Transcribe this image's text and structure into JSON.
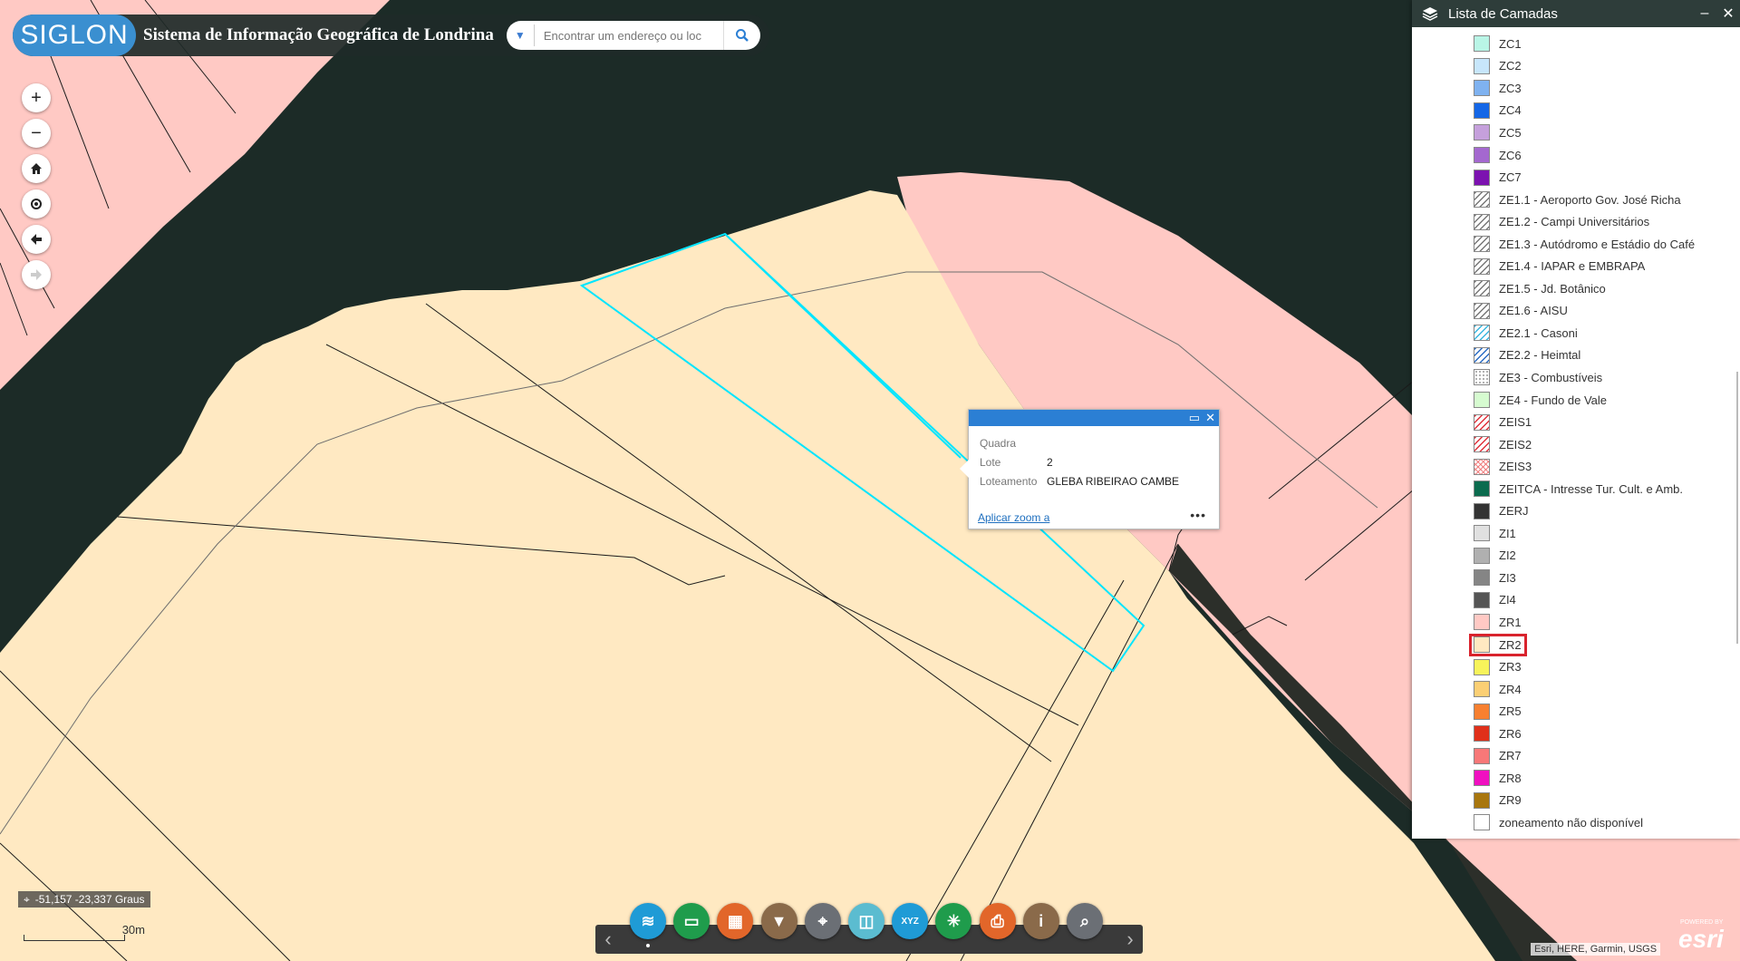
{
  "header": {
    "logo_text": "SIGLON",
    "app_title": "Sistema de Informação Geográfica de Londrina",
    "search_placeholder": "Encontrar um endereço ou loc"
  },
  "nav": [
    "zoom-in",
    "zoom-out",
    "home",
    "locate",
    "previous-extent",
    "next-extent"
  ],
  "popup": {
    "fields": [
      {
        "label": "Quadra",
        "value": ""
      },
      {
        "label": "Lote",
        "value": "2"
      },
      {
        "label": "Loteamento",
        "value": "GLEBA RIBEIRAO CAMBE"
      }
    ],
    "zoom_link": "Aplicar zoom a",
    "more": "•••"
  },
  "layer_panel": {
    "title": "Lista de Camadas",
    "minimize": "–",
    "close": "✕",
    "items": [
      {
        "label": "ZC1",
        "color": "#b9f5e6",
        "pattern": "solid"
      },
      {
        "label": "ZC2",
        "color": "#c7e6fb",
        "pattern": "solid"
      },
      {
        "label": "ZC3",
        "color": "#7fb2f0",
        "pattern": "solid"
      },
      {
        "label": "ZC4",
        "color": "#1466e6",
        "pattern": "solid"
      },
      {
        "label": "ZC5",
        "color": "#c5a0dc",
        "pattern": "solid"
      },
      {
        "label": "ZC6",
        "color": "#a468cf",
        "pattern": "solid"
      },
      {
        "label": "ZC7",
        "color": "#7c12b0",
        "pattern": "solid"
      },
      {
        "label": "ZE1.1 - Aeroporto Gov. José Richa",
        "color": "#777777",
        "pattern": "hatch"
      },
      {
        "label": "ZE1.2 - Campi Universitários",
        "color": "#777777",
        "pattern": "hatch"
      },
      {
        "label": "ZE1.3 - Autódromo e Estádio do Café",
        "color": "#777777",
        "pattern": "hatch"
      },
      {
        "label": "ZE1.4 - IAPAR e EMBRAPA",
        "color": "#777777",
        "pattern": "hatch"
      },
      {
        "label": "ZE1.5 - Jd. Botânico",
        "color": "#777777",
        "pattern": "hatch"
      },
      {
        "label": "ZE1.6 - AISU",
        "color": "#777777",
        "pattern": "hatch"
      },
      {
        "label": "ZE2.1 - Casoni",
        "color": "#39b7e0",
        "pattern": "hatch"
      },
      {
        "label": "ZE2.2 - Heimtal",
        "color": "#2a6cc4",
        "pattern": "hatch"
      },
      {
        "label": "ZE3 - Combustíveis",
        "color": "#999999",
        "pattern": "dots"
      },
      {
        "label": "ZE4 - Fundo de Vale",
        "color": "#d6fbd0",
        "pattern": "solid"
      },
      {
        "label": "ZEIS1",
        "color": "#e0303a",
        "pattern": "hatch"
      },
      {
        "label": "ZEIS2",
        "color": "#e0303a",
        "pattern": "hatch"
      },
      {
        "label": "ZEIS3",
        "color": "#f08080",
        "pattern": "cross"
      },
      {
        "label": "ZEITCA - Intresse Tur. Cult. e Amb.",
        "color": "#0b6b4e",
        "pattern": "solid"
      },
      {
        "label": "ZERJ",
        "color": "#333333",
        "pattern": "solid"
      },
      {
        "label": "ZI1",
        "color": "#e0e0e0",
        "pattern": "solid"
      },
      {
        "label": "ZI2",
        "color": "#b0b0b0",
        "pattern": "solid"
      },
      {
        "label": "ZI3",
        "color": "#858585",
        "pattern": "solid"
      },
      {
        "label": "ZI4",
        "color": "#555555",
        "pattern": "solid"
      },
      {
        "label": "ZR1",
        "color": "#ffc9c4",
        "pattern": "solid"
      },
      {
        "label": "ZR2",
        "color": "#ffe9c2",
        "pattern": "solid",
        "highlighted": true
      },
      {
        "label": "ZR3",
        "color": "#f7f35a",
        "pattern": "solid"
      },
      {
        "label": "ZR4",
        "color": "#fbcf74",
        "pattern": "solid"
      },
      {
        "label": "ZR5",
        "color": "#f88030",
        "pattern": "solid"
      },
      {
        "label": "ZR6",
        "color": "#e0301a",
        "pattern": "solid"
      },
      {
        "label": "ZR7",
        "color": "#f87878",
        "pattern": "solid"
      },
      {
        "label": "ZR8",
        "color": "#f010c0",
        "pattern": "solid"
      },
      {
        "label": "ZR9",
        "color": "#a8760e",
        "pattern": "solid"
      },
      {
        "label": "zoneamento não disponível",
        "color": "#ffffff",
        "pattern": "solid"
      }
    ]
  },
  "coords": {
    "text": "-51,157 -23,337 Graus"
  },
  "scale": {
    "text": "30m"
  },
  "toolbar": {
    "prev": "‹",
    "next": "›",
    "tools": [
      {
        "name": "layers-tool",
        "glyph": "≋",
        "color": "#1f9bd6"
      },
      {
        "name": "measure-tool",
        "glyph": "▭",
        "color": "#1f9c4c"
      },
      {
        "name": "basemap-tool",
        "glyph": "▦",
        "color": "#e2662a"
      },
      {
        "name": "filter-tool",
        "glyph": "▼",
        "color": "#8a6a4a"
      },
      {
        "name": "location-tool",
        "glyph": "⌖",
        "color": "#6b6f75"
      },
      {
        "name": "swipe-tool",
        "glyph": "◫",
        "color": "#5bbcd0"
      },
      {
        "name": "xyz-tool",
        "glyph": "XYZ",
        "color": "#1f9bd6"
      },
      {
        "name": "share-tool",
        "glyph": "✳",
        "color": "#1f9c4c"
      },
      {
        "name": "print-tool",
        "glyph": "⎙",
        "color": "#e2662a"
      },
      {
        "name": "info-tool",
        "glyph": "i",
        "color": "#8a6a4a"
      },
      {
        "name": "query-tool",
        "glyph": "⌕",
        "color": "#6b6f75"
      }
    ]
  },
  "attribution": "Esri, HERE, Garmin, USGS",
  "esri": {
    "powered": "POWERED BY",
    "brand": "esri"
  },
  "colors": {
    "water": "#1b2a26",
    "zr1": "#ffc9c4",
    "zr2": "#ffe9c2",
    "selection": "#00e5ff"
  }
}
